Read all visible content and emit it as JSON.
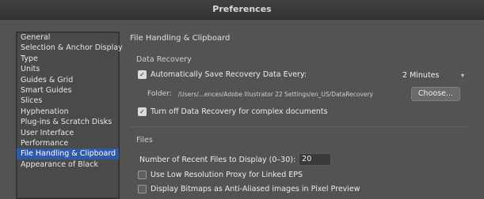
{
  "window": {
    "title": "Preferences"
  },
  "sidebar": {
    "items": [
      {
        "label": "General"
      },
      {
        "label": "Selection & Anchor Display"
      },
      {
        "label": "Type"
      },
      {
        "label": "Units"
      },
      {
        "label": "Guides & Grid"
      },
      {
        "label": "Smart Guides"
      },
      {
        "label": "Slices"
      },
      {
        "label": "Hyphenation"
      },
      {
        "label": "Plug-ins & Scratch Disks"
      },
      {
        "label": "User Interface"
      },
      {
        "label": "Performance"
      },
      {
        "label": "File Handling & Clipboard"
      },
      {
        "label": "Appearance of Black"
      }
    ],
    "selected_index": 11
  },
  "main": {
    "section_title": "File Handling & Clipboard",
    "data_recovery": {
      "group_label": "Data Recovery",
      "auto_save_label": "Automatically Save Recovery Data Every:",
      "auto_save_checked": true,
      "interval_value": "2 Minutes",
      "folder_label": "Folder:",
      "folder_path": "/Users/...ences/Adobe Illustrator 22 Settings/en_US/DataRecovery",
      "choose_label": "Choose...",
      "turn_off_label": "Turn off Data Recovery for complex documents",
      "turn_off_checked": true
    },
    "files": {
      "group_label": "Files",
      "recent_files_label": "Number of Recent Files to Display (0–30):",
      "recent_files_value": "20",
      "low_res_label": "Use Low Resolution Proxy for Linked EPS",
      "low_res_checked": false,
      "antialias_label": "Display Bitmaps as Anti-Aliased images in Pixel Preview",
      "antialias_checked": false
    }
  }
}
